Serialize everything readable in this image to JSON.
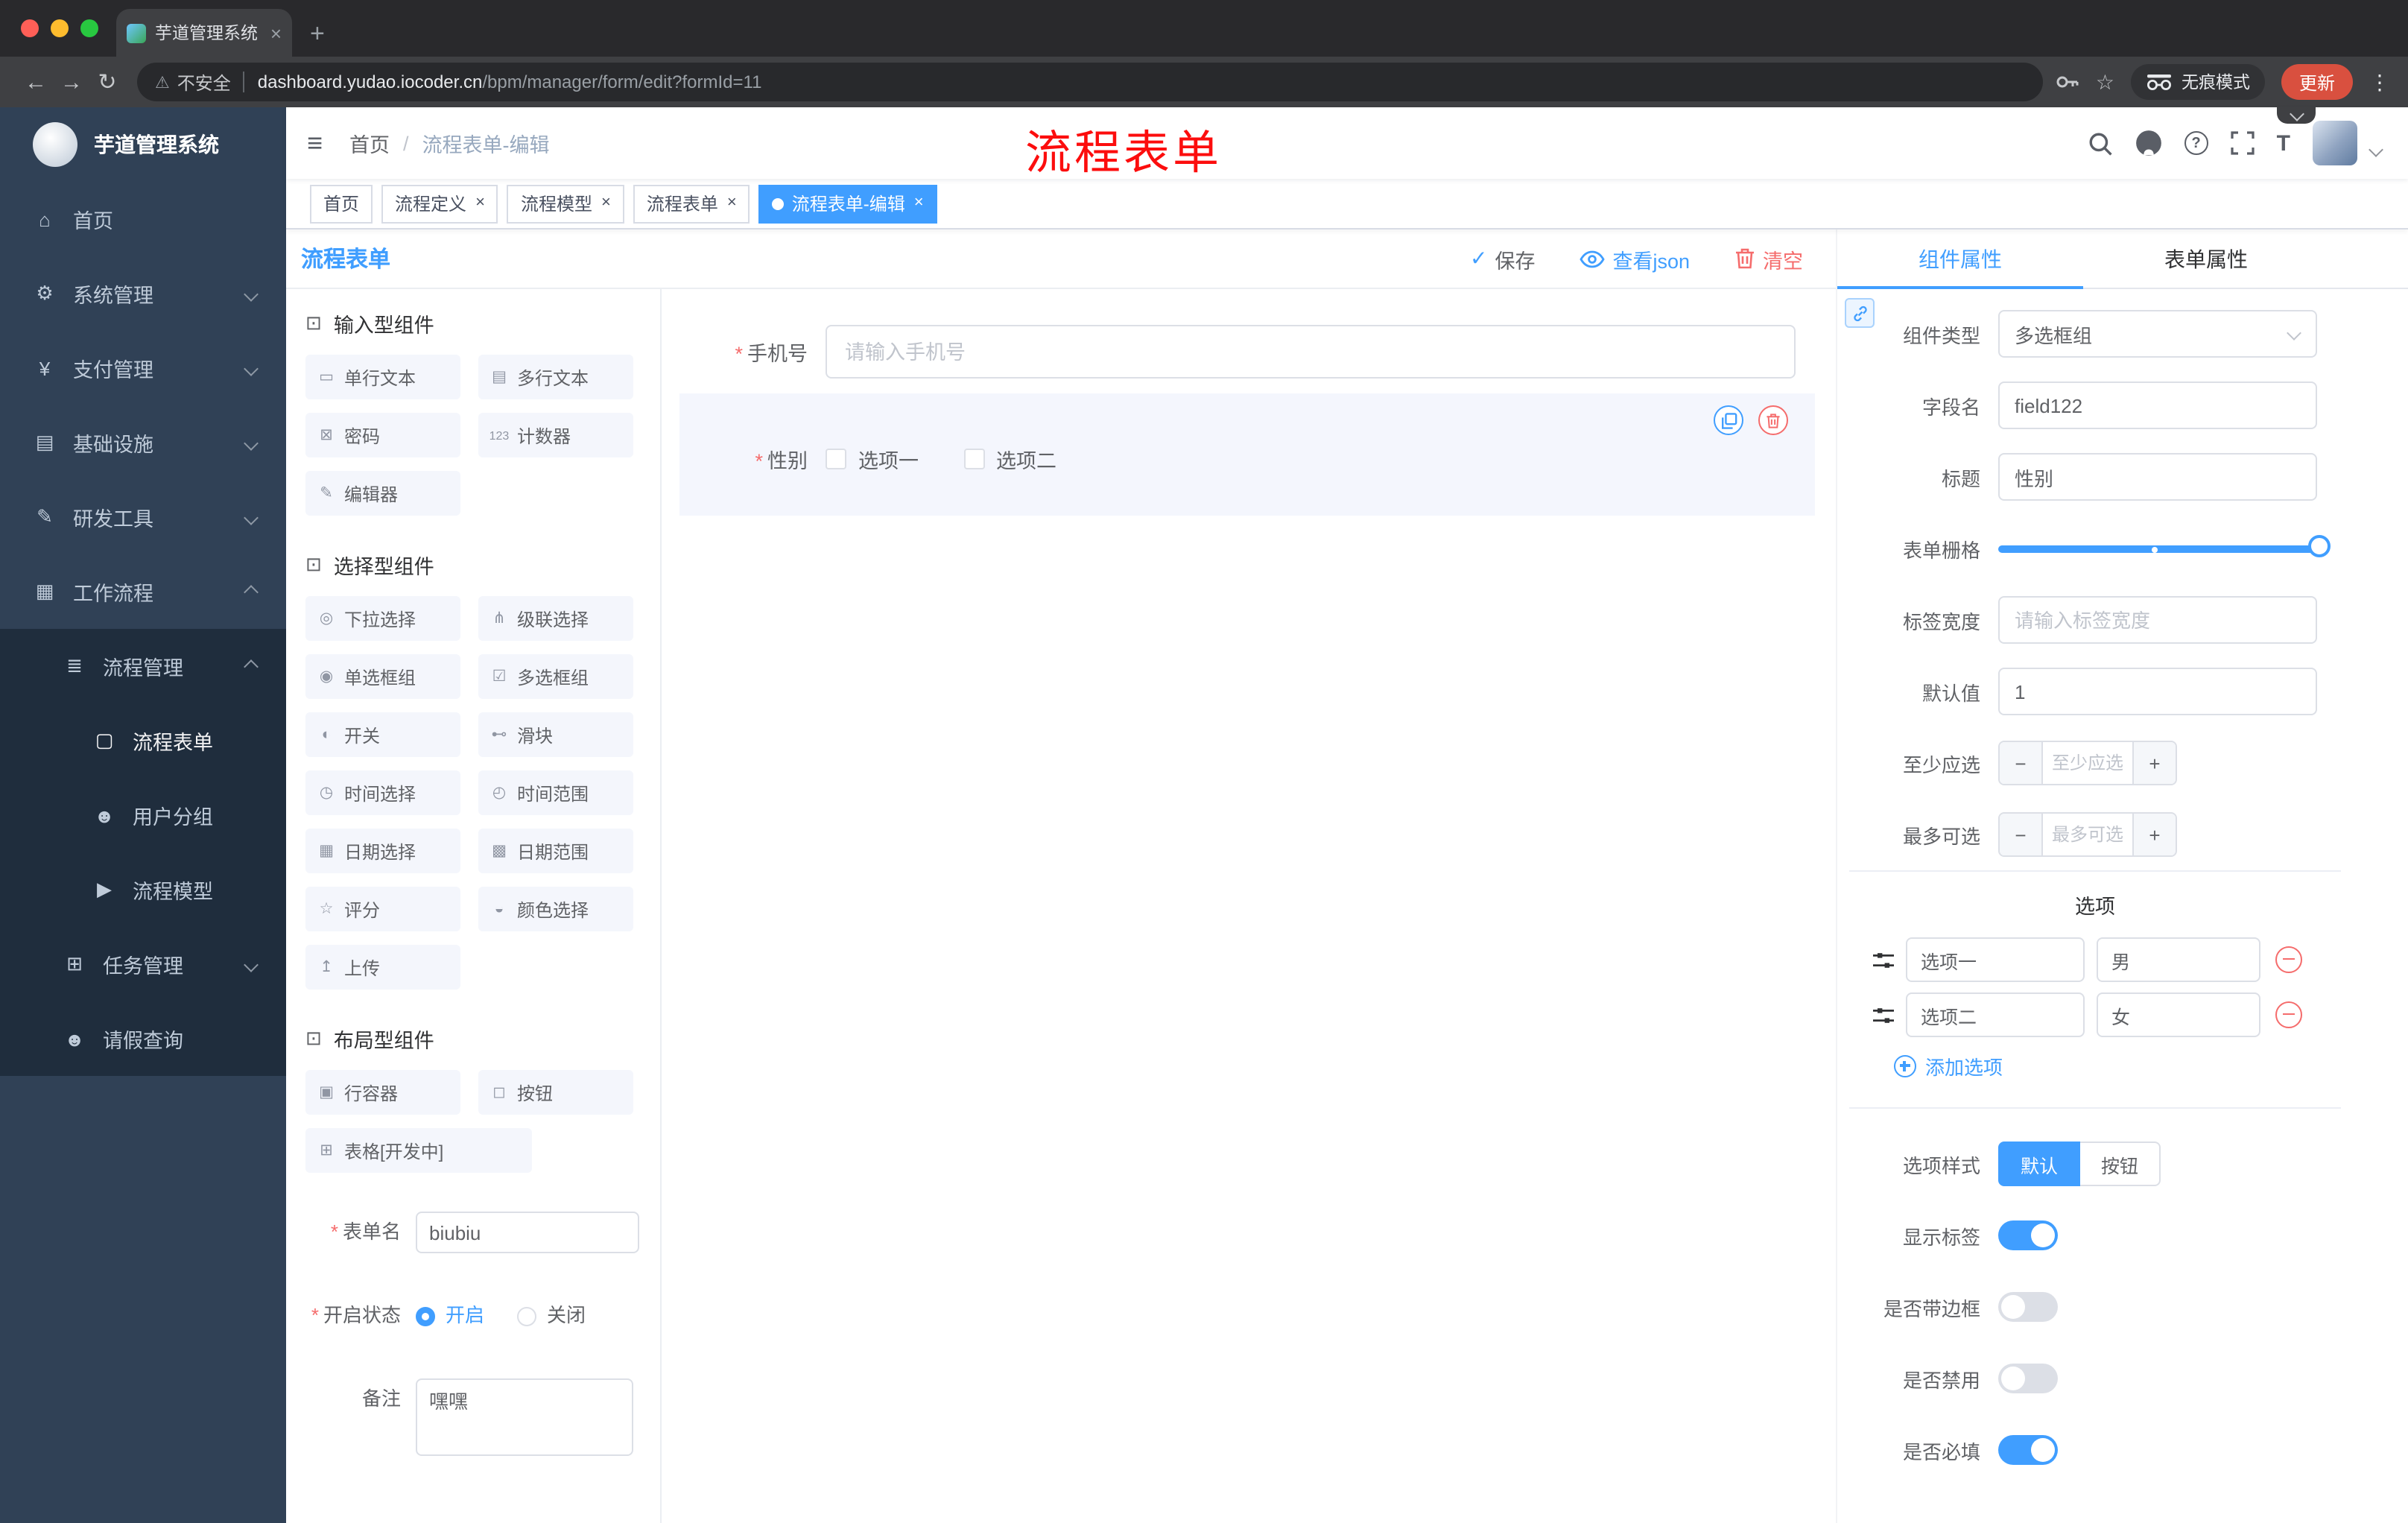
{
  "browser": {
    "tab_title": "芋道管理系统",
    "security_label": "不安全",
    "url_host": "dashboard.yudao.iocoder.cn",
    "url_path": "/bpm/manager/form/edit?formId=11",
    "incognito_label": "无痕模式",
    "update_label": "更新"
  },
  "sidebar": {
    "brand": "芋道管理系统",
    "items": [
      {
        "label": "首页"
      },
      {
        "label": "系统管理"
      },
      {
        "label": "支付管理"
      },
      {
        "label": "基础设施"
      },
      {
        "label": "研发工具"
      },
      {
        "label": "工作流程"
      },
      {
        "label": "流程管理"
      },
      {
        "label": "流程表单"
      },
      {
        "label": "用户分组"
      },
      {
        "label": "流程模型"
      },
      {
        "label": "任务管理"
      },
      {
        "label": "请假查询"
      }
    ]
  },
  "header": {
    "breadcrumb_home": "首页",
    "breadcrumb_sep": "/",
    "breadcrumb_current": "流程表单-编辑",
    "annotation": "流程表单"
  },
  "tags": [
    {
      "label": "首页"
    },
    {
      "label": "流程定义"
    },
    {
      "label": "流程模型"
    },
    {
      "label": "流程表单"
    },
    {
      "label": "流程表单-编辑"
    }
  ],
  "designer": {
    "title": "流程表单",
    "save_label": "保存",
    "view_json_label": "查看json",
    "clear_label": "清空"
  },
  "palette": {
    "sections": [
      {
        "title": "输入型组件",
        "items": [
          "单行文本",
          "多行文本",
          "密码",
          "计数器",
          "编辑器"
        ]
      },
      {
        "title": "选择型组件",
        "items": [
          "下拉选择",
          "级联选择",
          "单选框组",
          "多选框组",
          "开关",
          "滑块",
          "时间选择",
          "时间范围",
          "日期选择",
          "日期范围",
          "评分",
          "颜色选择",
          "上传"
        ]
      },
      {
        "title": "布局型组件",
        "items": [
          "行容器",
          "按钮",
          "表格[开发中]"
        ]
      }
    ],
    "form": {
      "name_label": "表单名",
      "name_value": "biubiu",
      "status_label": "开启状态",
      "status_on": "开启",
      "status_off": "关闭",
      "remark_label": "备注",
      "remark_value": "嘿嘿"
    }
  },
  "canvas": {
    "phone_label": "手机号",
    "phone_placeholder": "请输入手机号",
    "gender_label": "性别",
    "gender_opt1": "选项一",
    "gender_opt2": "选项二"
  },
  "props": {
    "tab_component": "组件属性",
    "tab_form": "表单属性",
    "type_label": "组件类型",
    "type_value": "多选框组",
    "field_label": "字段名",
    "field_value": "field122",
    "title_label": "标题",
    "title_value": "性别",
    "grid_label": "表单栅格",
    "labelwidth_label": "标签宽度",
    "labelwidth_placeholder": "请输入标签宽度",
    "default_label": "默认值",
    "default_value": "1",
    "min_label": "至少应选",
    "min_placeholder": "至少应选",
    "max_label": "最多可选",
    "max_placeholder": "最多可选",
    "options_title": "选项",
    "options": [
      {
        "label": "选项一",
        "value": "男"
      },
      {
        "label": "选项二",
        "value": "女"
      }
    ],
    "add_option_label": "添加选项",
    "style_label": "选项样式",
    "style_default": "默认",
    "style_button": "按钮",
    "switches": [
      {
        "label": "显示标签",
        "on": true
      },
      {
        "label": "是否带边框",
        "on": false
      },
      {
        "label": "是否禁用",
        "on": false
      },
      {
        "label": "是否必填",
        "on": true
      }
    ]
  },
  "colors": {
    "accent": "#409eff",
    "danger": "#f56c6c",
    "sidebar_bg": "#304156",
    "submenu_bg": "#1f2d3d",
    "update_button": "#d9503f",
    "active_tag": "#409eff"
  },
  "icons": {
    "close": "×",
    "new_tab": "+",
    "back": "←",
    "forward": "→",
    "reload": "↻",
    "warning": "⚠",
    "star": "☆",
    "dots": "⋮",
    "hamburger": "≡",
    "question": "?",
    "fontsize": "T",
    "home": "⌂",
    "gear": "⚙",
    "pay": "¥",
    "infra": "▤",
    "tools": "✎",
    "workflow": "▦",
    "list": "≣",
    "doc": "▢",
    "users": "☻",
    "send": "▶",
    "tree": "⊞",
    "person": "☻",
    "cube": "⊡",
    "input": "▭",
    "textarea": "▤",
    "password": "⊠",
    "counter": "123",
    "editor": "✎",
    "select": "◎",
    "cascader": "⋔",
    "radio": "◉",
    "checkbox": "☑",
    "switch": "◐",
    "slider": "⊷",
    "time": "◷",
    "timerange": "◴",
    "date": "▦",
    "daterange": "▩",
    "rate": "☆",
    "color": "◒",
    "upload": "↥",
    "row": "▣",
    "button": "◻",
    "table": "⊞",
    "check": "✓",
    "minus": "−",
    "plus": "+"
  }
}
